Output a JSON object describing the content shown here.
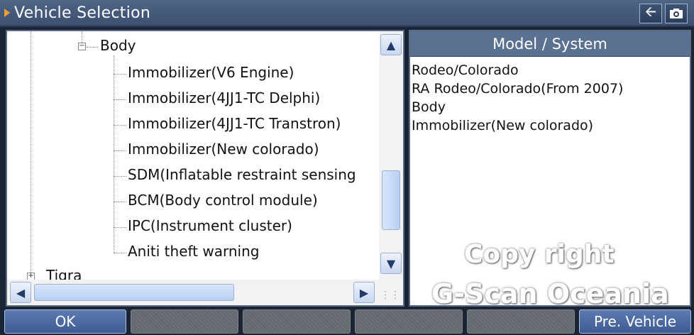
{
  "window": {
    "title": "Vehicle Selection",
    "back_icon": "back-arrow-icon",
    "camera_icon": "camera-icon"
  },
  "tree": {
    "parent": "Body",
    "items": [
      "Immobilizer(V6 Engine)",
      "Immobilizer(4JJ1-TC Delphi)",
      "Immobilizer(4JJ1-TC Transtron)",
      "Immobilizer(New colorado)",
      "SDM(Inflatable restraint sensing",
      "BCM(Body control module)",
      "IPC(Instrument cluster)",
      "Aniti theft warning"
    ],
    "next_partial": "Tigra"
  },
  "model_panel": {
    "header": "Model / System",
    "rows": [
      "Rodeo/Colorado",
      "RA Rodeo/Colorado(From 2007)",
      "Body",
      "Immobilizer(New colorado)"
    ]
  },
  "watermark": {
    "line1": "Copy right",
    "line2": "G-Scan Oceania"
  },
  "buttons": {
    "ok": "OK",
    "pre_vehicle": "Pre. Vehicle"
  }
}
